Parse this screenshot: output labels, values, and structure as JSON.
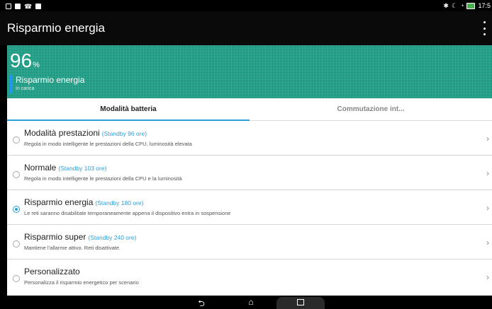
{
  "status_bar": {
    "time": "17:5",
    "icons_left": [
      "notification-icon",
      "message-icon",
      "call-icon",
      "sim-icon"
    ],
    "icons_right": [
      "bluetooth-icon",
      "moon-icon",
      "wifi-icon",
      "battery-charging-icon"
    ]
  },
  "header": {
    "title": "Risparmio energia"
  },
  "hero": {
    "percent": "96",
    "percent_symbol": "%",
    "mode_title": "Risparmio energia",
    "mode_status": "In carica",
    "accent_color": "#1e9c84"
  },
  "tabs": [
    {
      "label": "Modalità batteria",
      "active": true
    },
    {
      "label": "Commutazione int...",
      "active": false
    }
  ],
  "modes": [
    {
      "name": "Modalità prestazioni",
      "standby": "(Standby 96 ore)",
      "desc": "Regola in modo intelligente le prestazioni della CPU, luminosità elevata",
      "selected": false
    },
    {
      "name": "Normale",
      "standby": "(Standby 103 ore)",
      "desc": "Regola in modo intelligente le prestazioni della CPU e la luminosità",
      "selected": false
    },
    {
      "name": "Risparmio energia",
      "standby": "(Standby 180 ore)",
      "desc": "Le reti saranno disabilitate temporaneamente appena il dispositivo entra in sospensione",
      "selected": true
    },
    {
      "name": "Risparmio super",
      "standby": "(Standby 240 ore)",
      "desc": "Mantiene l'allarme attivo. Reti disattivate.",
      "selected": false
    },
    {
      "name": "Personalizzato",
      "standby": "",
      "desc": "Personalizza il risparmio energetico per scenario",
      "selected": false
    }
  ],
  "nav": {
    "icons": [
      "back-icon",
      "home-icon",
      "recent-apps-icon"
    ]
  },
  "colors": {
    "accent": "#2b9fd8",
    "hero": "#1e9c84"
  }
}
